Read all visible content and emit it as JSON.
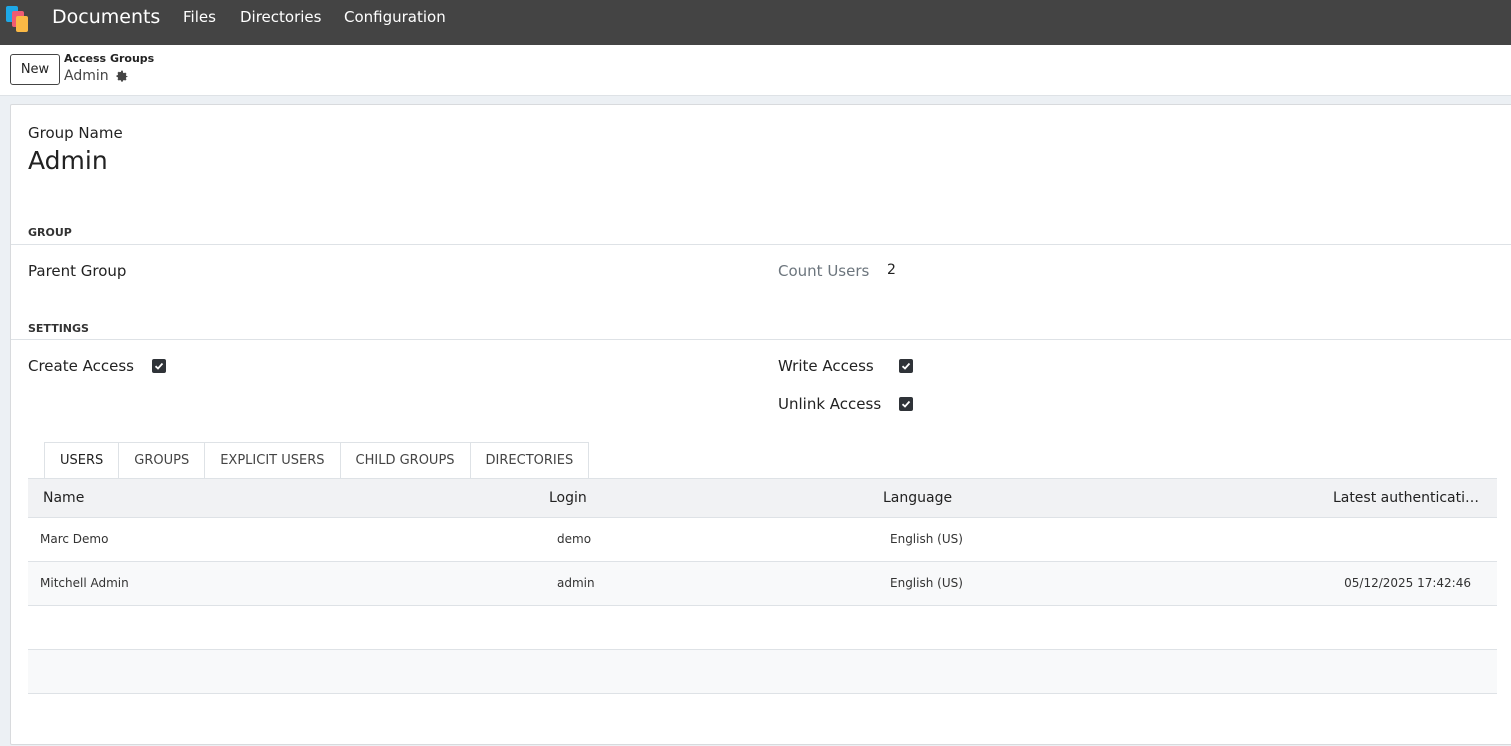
{
  "topbar": {
    "app_name": "Documents",
    "menu": [
      "Files",
      "Directories",
      "Configuration"
    ]
  },
  "control_panel": {
    "new_label": "New",
    "breadcrumb_parent": "Access Groups",
    "breadcrumb_current": "Admin"
  },
  "form": {
    "group_name_label": "Group Name",
    "group_name_value": "Admin",
    "section_group": "GROUP",
    "parent_group_label": "Parent Group",
    "count_users_label": "Count Users",
    "count_users_value": "2",
    "section_settings": "SETTINGS",
    "create_access_label": "Create Access",
    "create_access_checked": true,
    "write_access_label": "Write Access",
    "write_access_checked": true,
    "unlink_access_label": "Unlink Access",
    "unlink_access_checked": true
  },
  "tabs": [
    {
      "label": "USERS",
      "active": true
    },
    {
      "label": "GROUPS",
      "active": false
    },
    {
      "label": "EXPLICIT USERS",
      "active": false
    },
    {
      "label": "CHILD GROUPS",
      "active": false
    },
    {
      "label": "DIRECTORIES",
      "active": false
    }
  ],
  "users_table": {
    "columns": [
      "Name",
      "Login",
      "Language",
      "Latest authenticati…"
    ],
    "rows": [
      {
        "name": "Marc Demo",
        "login": "demo",
        "language": "English (US)",
        "latest_auth": ""
      },
      {
        "name": "Mitchell Admin",
        "login": "admin",
        "language": "English (US)",
        "latest_auth": "05/12/2025 17:42:46"
      }
    ]
  },
  "colors": {
    "topbar_bg": "#444444",
    "checkbox_fill": "#2f3338"
  }
}
